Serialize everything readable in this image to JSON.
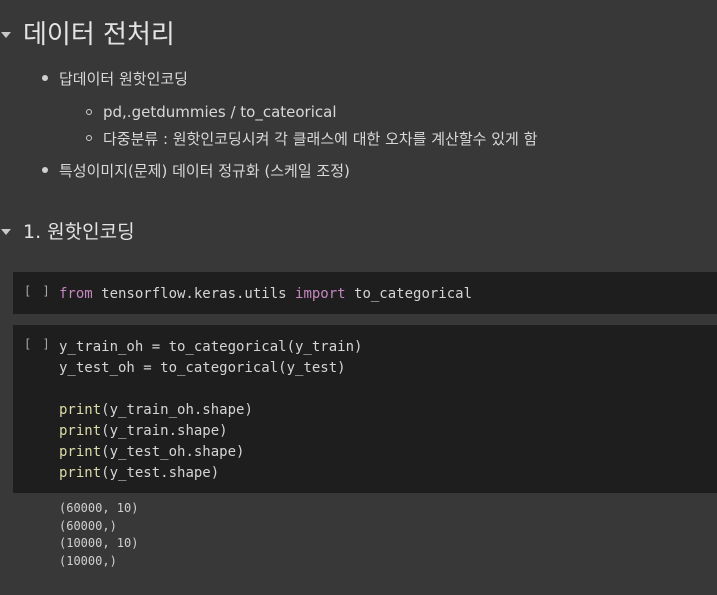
{
  "section1": {
    "title": "데이터 전처리",
    "bullets": [
      {
        "text": "답데이터 원핫인코딩"
      },
      {
        "text": "특성이미지(문제) 데이터 정규화 (스케일 조정)"
      }
    ],
    "sub_bullets": [
      {
        "text": "pd,.getdummies / to_cateorical"
      },
      {
        "text": "다중분류 : 원핫인코딩시켜 각 클래스에 대한 오차를 계산할수 있게 함"
      }
    ]
  },
  "section2": {
    "title": "1. 원핫인코딩"
  },
  "cells": [
    {
      "run_indicator": "[ ]",
      "import_line": {
        "kw_from": "from",
        "module": " tensorflow.keras.utils ",
        "kw_import": "import",
        "name": " to_categorical"
      }
    },
    {
      "run_indicator": "[ ]",
      "lines": {
        "l1": "y_train_oh = to_categorical(y_train)",
        "l2": "y_test_oh = to_categorical(y_test)",
        "print_kw": "print",
        "p1": "(y_train_oh.shape)",
        "p2": "(y_train.shape)",
        "p3": "(y_test_oh.shape)",
        "p4": "(y_test.shape)"
      }
    }
  ],
  "output_lines": [
    "(60000, 10)",
    "(60000,)",
    "(10000, 10)",
    "(10000,)"
  ]
}
